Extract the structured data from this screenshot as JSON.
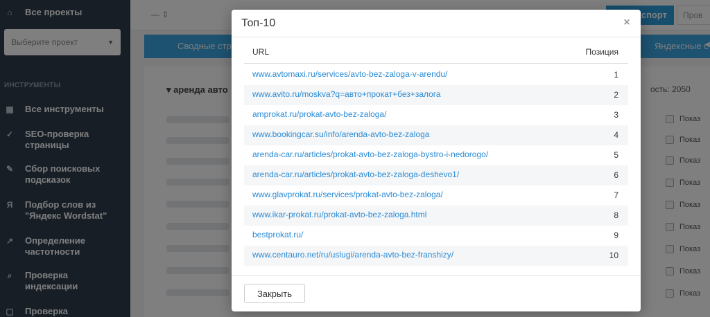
{
  "sidebar": {
    "top_item": "Все проекты",
    "select_placeholder": "Выберите проект",
    "heading": "ИНСТРУМЕНТЫ",
    "items": [
      {
        "label": "Все инструменты"
      },
      {
        "label": "SEO-проверка страницы"
      },
      {
        "label": "Сбор поисковых подсказок"
      },
      {
        "label": "Подбор слов из \"Яндекс Wordstat\""
      },
      {
        "label": "Определение частотности"
      },
      {
        "label": "Проверка индексации"
      },
      {
        "label": "Проверка"
      }
    ]
  },
  "topbar": {
    "input_text": "—  ⇕",
    "export_label": "Экспорт",
    "other_label": "Пров"
  },
  "tabbar": {
    "left_label": "Сводные стр",
    "right_label": "Яндексные с"
  },
  "content": {
    "title": "▾ аренда авто",
    "right_text": "ость: 2050",
    "chip_label": "Показ"
  },
  "modal": {
    "title": "Топ-10",
    "columns": {
      "url": "URL",
      "position": "Позиция"
    },
    "rows": [
      {
        "url": "www.avtomaxi.ru/services/avto-bez-zaloga-v-arendu/",
        "position": "1"
      },
      {
        "url": "www.avito.ru/moskva?q=авто+прокат+без+залога",
        "position": "2"
      },
      {
        "url": "amprokat.ru/prokat-avto-bez-zaloga/",
        "position": "3"
      },
      {
        "url": "www.bookingcar.su/info/arenda-avto-bez-zaloga",
        "position": "4"
      },
      {
        "url": "arenda-car.ru/articles/prokat-avto-bez-zaloga-bystro-i-nedorogo/",
        "position": "5"
      },
      {
        "url": "arenda-car.ru/articles/prokat-avto-bez-zaloga-deshevo1/",
        "position": "6"
      },
      {
        "url": "www.glavprokat.ru/services/prokat-avto-bez-zaloga/",
        "position": "7"
      },
      {
        "url": "www.ikar-prokat.ru/prokat-avto-bez-zaloga.html",
        "position": "8"
      },
      {
        "url": "bestprokat.ru/",
        "position": "9"
      },
      {
        "url": "www.centauro.net/ru/uslugi/arenda-avto-bez-franshizy/",
        "position": "10"
      }
    ],
    "close_button": "Закрыть",
    "close_icon": "×"
  }
}
